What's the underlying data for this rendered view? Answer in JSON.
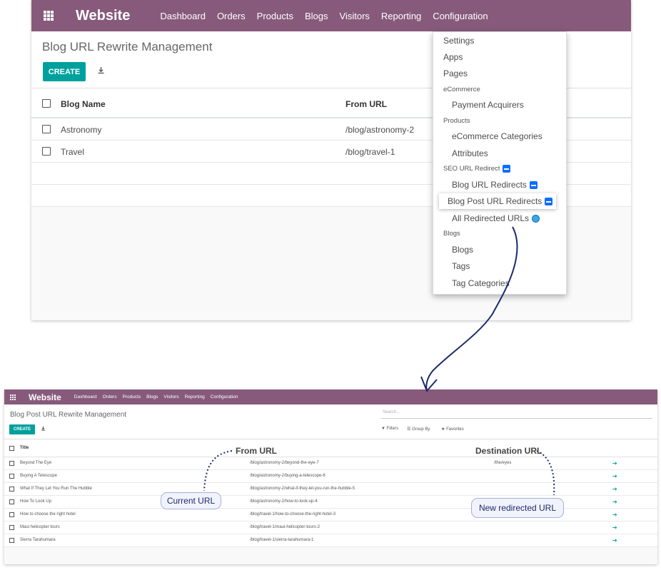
{
  "top": {
    "brand": "Website",
    "menu": [
      "Dashboard",
      "Orders",
      "Products",
      "Blogs",
      "Visitors",
      "Reporting",
      "Configuration"
    ],
    "title": "Blog URL Rewrite Management",
    "create_label": "CREATE",
    "download_icon": "download-icon",
    "columns": [
      "Blog Name",
      "From URL"
    ],
    "rows": [
      {
        "name": "Astronomy",
        "from": "/blog/astronomy-2"
      },
      {
        "name": "Travel",
        "from": "/blog/travel-1"
      }
    ],
    "dropdown": {
      "settings": "Settings",
      "apps": "Apps",
      "pages": "Pages",
      "ecommerce": "eCommerce",
      "payment_acquirers": "Payment Acquirers",
      "products": "Products",
      "ecommerce_categories": "eCommerce Categories",
      "attributes": "Attributes",
      "seo_url_redirect": "SEO URL Redirect",
      "blog_url_redirects": "Blog URL Redirects",
      "blog_post_url_redirects": "Blog Post URL Redirects",
      "all_redirected_urls": "All Redirected URLs",
      "blogs_head": "Blogs",
      "blogs": "Blogs",
      "tags": "Tags",
      "tag_categories": "Tag Categories"
    }
  },
  "bottom": {
    "brand": "Website",
    "menu": [
      "Dashboard",
      "Orders",
      "Products",
      "Blogs",
      "Visitors",
      "Reporting",
      "Configuration"
    ],
    "title": "Blog Post URL Rewrite Management",
    "create_label": "CREATE",
    "search_placeholder": "Search...",
    "filters": "Filters",
    "group_by": "Group By",
    "favorites": "Favorites",
    "column_title": "Title",
    "rows": [
      {
        "title": "Beyond The Eye",
        "from": "/blog/astronomy-2/beyond-the-eye-7",
        "dest": "/the/eyes"
      },
      {
        "title": "Buying A Telescope",
        "from": "/blog/astronomy-2/buying-a-telescope-6",
        "dest": ""
      },
      {
        "title": "What If They Let You Run The Hubble",
        "from": "/blog/astronomy-2/what-if-they-let-you-run-the-hubble-5",
        "dest": ""
      },
      {
        "title": "How To Look Up",
        "from": "/blog/astronomy-2/how-to-look-up-4",
        "dest": ""
      },
      {
        "title": "How to choose the right hotel",
        "from": "/blog/travel-1/how-to-choose-the-right-hotel-3",
        "dest": ""
      },
      {
        "title": "Maui helicopter tours",
        "from": "/blog/travel-1/maui-helicopter-tours-2",
        "dest": ""
      },
      {
        "title": "Sierra Tarahumara",
        "from": "/blog/travel-1/sierra-tarahumara-1",
        "dest": ""
      }
    ]
  },
  "annotations": {
    "from_url": "From URL",
    "destination_url": "Destination URL",
    "current_url": "Current URL",
    "new_redirected_url": "New redirected URL"
  },
  "colors": {
    "navbar": "#875a7b",
    "primary": "#00a09d",
    "annotation_line": "#1c2a6b",
    "bubble_bg": "#f1f3fc"
  }
}
